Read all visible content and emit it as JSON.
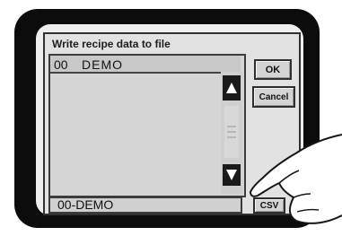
{
  "dialog": {
    "title": "Write recipe data to file",
    "list": {
      "items": [
        {
          "number": "00",
          "name": "DEMO"
        }
      ]
    },
    "buttons": {
      "ok": "OK",
      "cancel": "Cancel",
      "csv": "CSV"
    },
    "filename_value": "00-DEMO"
  },
  "icons": {
    "scroll_up": "triangle-up-icon",
    "scroll_down": "triangle-down-icon",
    "hand": "pointing-hand-icon"
  },
  "colors": {
    "bezel": "#0c0c0c",
    "dialog_background": "#e2e2e2",
    "button_face": "#d4d4d4",
    "scroll_arrow": "#1a1a1a"
  }
}
